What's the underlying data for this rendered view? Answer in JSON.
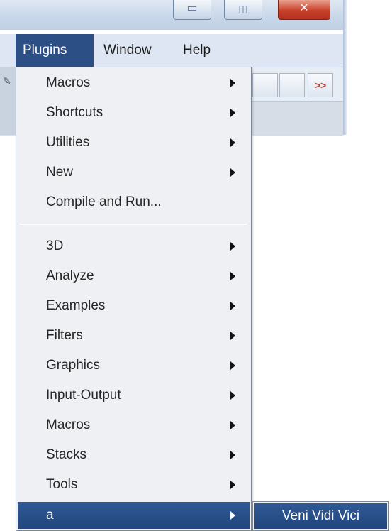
{
  "window": {
    "controls": {
      "minimize_glyph": "▭",
      "maximize_glyph": "◫",
      "close_glyph": "✕"
    }
  },
  "menubar": {
    "items": [
      {
        "label": "Plugins",
        "active": true
      },
      {
        "label": "Window",
        "active": false
      },
      {
        "label": "Help",
        "active": false
      }
    ]
  },
  "toolbar": {
    "more_glyph": ">>",
    "edge_glyph": "✎"
  },
  "plugins_menu": {
    "group1": [
      {
        "label": "Macros",
        "submenu": true
      },
      {
        "label": "Shortcuts",
        "submenu": true
      },
      {
        "label": "Utilities",
        "submenu": true
      },
      {
        "label": "New",
        "submenu": true
      },
      {
        "label": "Compile and Run...",
        "submenu": false
      }
    ],
    "group2": [
      {
        "label": "3D",
        "submenu": true
      },
      {
        "label": "Analyze",
        "submenu": true
      },
      {
        "label": "Examples",
        "submenu": true
      },
      {
        "label": "Filters",
        "submenu": true
      },
      {
        "label": "Graphics",
        "submenu": true
      },
      {
        "label": "Input-Output",
        "submenu": true
      },
      {
        "label": "Macros",
        "submenu": true
      },
      {
        "label": "Stacks",
        "submenu": true
      },
      {
        "label": "Tools",
        "submenu": true
      },
      {
        "label": "a",
        "submenu": true,
        "highlighted": true
      }
    ]
  },
  "submenu_a": {
    "items": [
      {
        "label": "Veni Vidi Vici",
        "highlighted": true
      }
    ]
  },
  "colors": {
    "highlight": "#2c4f86",
    "menu_background": "#eef0f3",
    "close_button": "#c8402a"
  }
}
